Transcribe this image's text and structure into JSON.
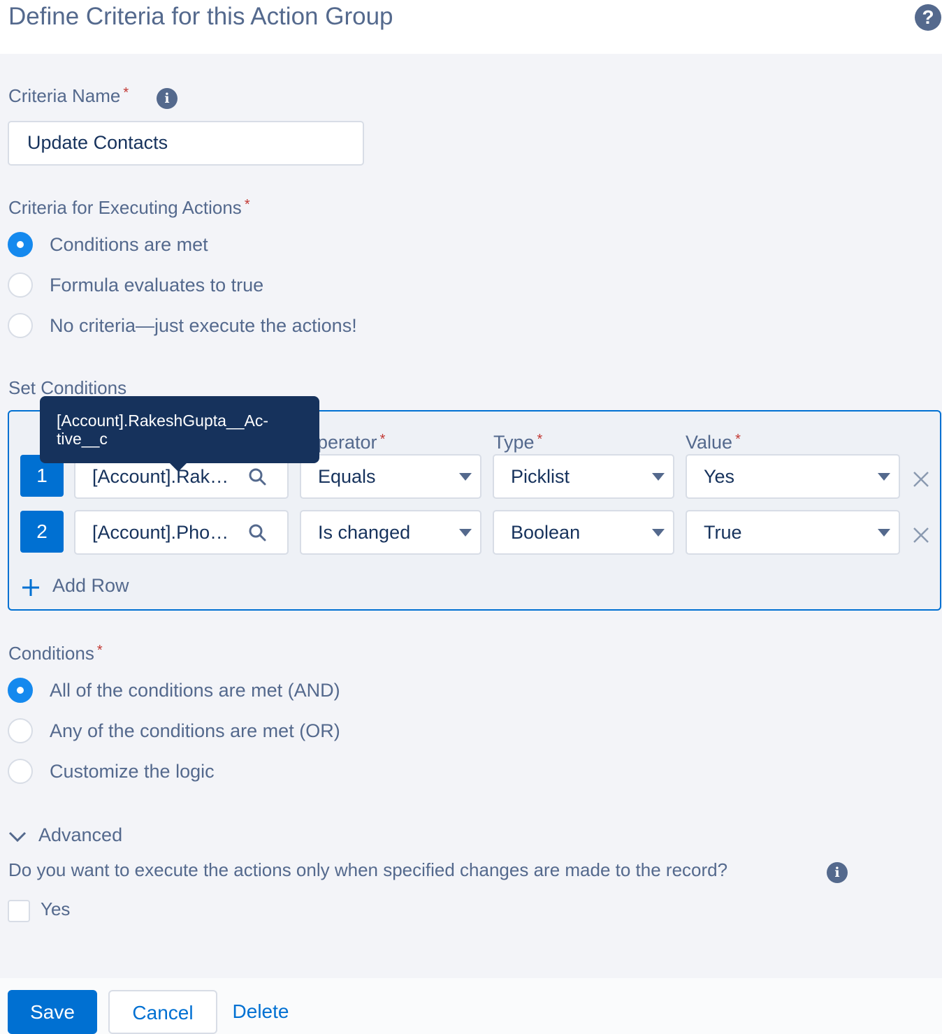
{
  "header": {
    "title": "Define Criteria for this Action Group",
    "help_icon": "?"
  },
  "criteria_name": {
    "label": "Criteria Name",
    "required_mark": "*",
    "info_icon": "i",
    "value": "Update Contacts"
  },
  "executing_actions": {
    "label": "Criteria for Executing Actions",
    "required_mark": "*",
    "options": [
      "Conditions are met",
      "Formula evaluates to true",
      "No criteria—just execute the actions!"
    ],
    "selected_index": 0
  },
  "set_conditions": {
    "label": "Set Conditions",
    "columns": {
      "operator": "Operator",
      "type": "Type",
      "value": "Value"
    },
    "required_mark": "*",
    "rows": [
      {
        "num": "1",
        "field": "[Account].Rak…",
        "operator": "Equals",
        "type": "Picklist",
        "value": "Yes"
      },
      {
        "num": "2",
        "field": "[Account].Pho…",
        "operator": "Is changed",
        "type": "Boolean",
        "value": "True"
      }
    ],
    "add_row_label": "Add Row",
    "tooltip": "[Account].RakeshGupta__Ac­tive__c"
  },
  "conditions": {
    "label": "Conditions",
    "required_mark": "*",
    "options": [
      "All of the conditions are met (AND)",
      "Any of the conditions are met (OR)",
      "Customize the logic"
    ],
    "selected_index": 0
  },
  "advanced": {
    "label": "Advanced",
    "question": "Do you want to execute the actions only when specified changes are made to the record?",
    "info_icon": "i",
    "checkbox_label": "Yes",
    "checked": false
  },
  "footer": {
    "save_label": "Save",
    "cancel_label": "Cancel",
    "delete_label": "Delete"
  },
  "colors": {
    "brand": "#0070d2",
    "label": "#54698d",
    "required": "#c23934",
    "tooltip_bg": "#16325c"
  }
}
